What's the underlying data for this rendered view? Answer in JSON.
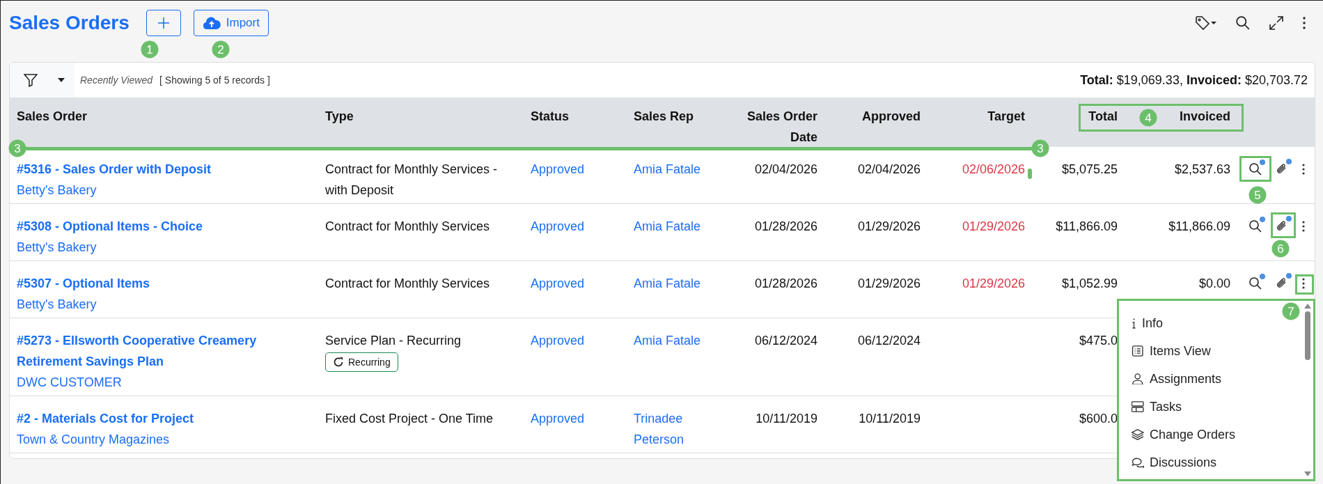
{
  "page": {
    "title": "Sales Orders",
    "import_label": "Import"
  },
  "toolbar": {
    "view": "Recently Viewed",
    "count": "[ Showing 5 of 5 records ]",
    "totals": "**Total:** $19,069.33, **Invoiced:** $20,703.72"
  },
  "table": {
    "columns": [
      "Sales Order",
      "Type",
      "Status",
      "Sales Rep",
      "Sales Order Date",
      "Approved",
      "Target",
      "Total",
      "Invoiced"
    ],
    "rows": [
      {
        "order": "#5316 - Sales Order with Deposit",
        "customer": "Betty's Bakery",
        "type": "Contract for Monthly Services - with Deposit",
        "status": "Approved",
        "rep": "Amia Fatale",
        "so_date": "02/04/2026",
        "approved": "02/04/2026",
        "target": "02/06/2026",
        "overdue": true,
        "flag": true,
        "total": "$5,075.25",
        "invoiced": "$2,537.63",
        "actions": {
          "search_dot": true,
          "attach_dot": true
        }
      },
      {
        "order": "#5308 - Optional Items - Choice",
        "customer": "Betty's Bakery",
        "type": "Contract for Monthly Services",
        "status": "Approved",
        "rep": "Amia Fatale",
        "so_date": "01/28/2026",
        "approved": "01/29/2026",
        "target": "01/29/2026",
        "overdue": true,
        "flag": false,
        "total": "$11,866.09",
        "invoiced": "$11,866.09",
        "actions": {
          "search_dot": true,
          "attach_dot": true
        }
      },
      {
        "order": "#5307 - Optional Items",
        "customer": "Betty's Bakery",
        "type": "Contract for Monthly Services",
        "status": "Approved",
        "rep": "Amia Fatale",
        "so_date": "01/28/2026",
        "approved": "01/29/2026",
        "target": "01/29/2026",
        "overdue": true,
        "flag": false,
        "total": "$1,052.99",
        "invoiced": "$0.00",
        "actions": {
          "search_dot": true,
          "attach_dot": true
        }
      },
      {
        "order": "#5273 - Ellsworth Cooperative Creamery Retirement Savings Plan",
        "customer": "DWC CUSTOMER",
        "type": "Service Plan - Recurring",
        "badge": "Recurring",
        "status": "Approved",
        "rep": "Amia Fatale",
        "so_date": "06/12/2024",
        "approved": "06/12/2024",
        "flag": false,
        "total": "$475.0"
      },
      {
        "order": "#2 - Materials Cost for Project",
        "customer": "Town & Country Magazines",
        "type": "Fixed Cost Project - One Time",
        "status": "Approved",
        "rep": "Trinadee Peterson",
        "so_date": "10/11/2019",
        "approved": "10/11/2019",
        "flag": false,
        "total": "$600.0"
      }
    ]
  },
  "row_menu": {
    "items": [
      "Info",
      "Items View",
      "Assignments",
      "Tasks",
      "Change Orders",
      "Discussions"
    ]
  },
  "callouts": [
    {
      "label": "1"
    },
    {
      "label": "2"
    },
    {
      "label": "3"
    },
    {
      "label": "3"
    },
    {
      "label": "4"
    },
    {
      "label": "5"
    },
    {
      "label": "6"
    },
    {
      "label": "7"
    }
  ]
}
